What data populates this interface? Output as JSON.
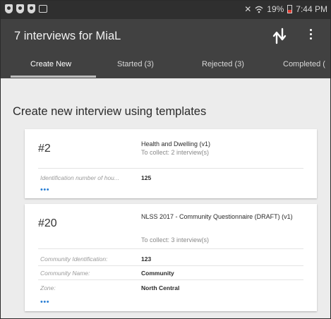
{
  "status_bar": {
    "battery": "19%",
    "time": "7:44 PM",
    "icons": [
      "shield-icon",
      "shield-icon",
      "shield-icon",
      "image-icon",
      "mute-icon",
      "wifi-icon",
      "battery-icon"
    ]
  },
  "app_bar": {
    "title": "7 interviews for MiaL",
    "icons": [
      "sync-icon",
      "more-vert-icon"
    ]
  },
  "tabs": [
    {
      "label": "Create New",
      "active": true
    },
    {
      "label": "Started (3)",
      "active": false
    },
    {
      "label": "Rejected (3)",
      "active": false
    },
    {
      "label": "Completed (",
      "active": false
    }
  ],
  "section_title": "Create new interview using templates",
  "cards": [
    {
      "number": "#2",
      "title": "Health and Dwelling (v1)",
      "collect": "To collect: 2 interview(s)",
      "rows": [
        {
          "label": "Identification number of hou...",
          "value": "125"
        }
      ],
      "more": "•••"
    },
    {
      "number": "#20",
      "title": "NLSS 2017 - Community Questionnaire (DRAFT) (v1)",
      "collect": "To collect: 3 interview(s)",
      "rows": [
        {
          "label": "Community Identification:",
          "value": "123"
        },
        {
          "label": "Community Name:",
          "value": "Community"
        },
        {
          "label": "Zone:",
          "value": "North Central"
        }
      ],
      "more": "•••"
    }
  ],
  "colors": {
    "app_bar": "#414141",
    "status_bar": "#2f2f2f",
    "background": "#ececec",
    "link_dots": "#2a7fd4",
    "battery_low": "#e03a2f"
  }
}
